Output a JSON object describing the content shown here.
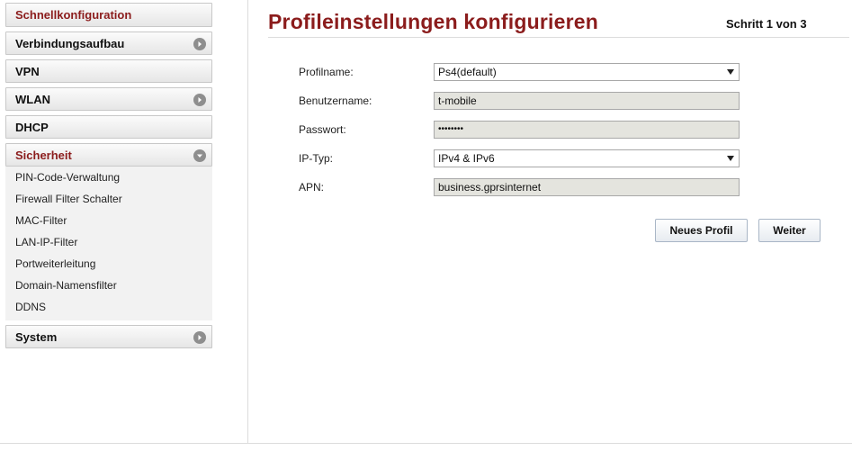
{
  "sidebar": {
    "items": [
      {
        "label": "Schnellkonfiguration"
      },
      {
        "label": "Verbindungsaufbau"
      },
      {
        "label": "VPN"
      },
      {
        "label": "WLAN"
      },
      {
        "label": "DHCP"
      },
      {
        "label": "Sicherheit"
      },
      {
        "label": "System"
      }
    ],
    "security_subitems": [
      {
        "label": "PIN-Code-Verwaltung"
      },
      {
        "label": "Firewall Filter Schalter"
      },
      {
        "label": "MAC-Filter"
      },
      {
        "label": "LAN-IP-Filter"
      },
      {
        "label": "Portweiterleitung"
      },
      {
        "label": "Domain-Namensfilter"
      },
      {
        "label": "DDNS"
      }
    ]
  },
  "main": {
    "title": "Profileinstellungen konfigurieren",
    "step": "Schritt 1 von 3",
    "form": {
      "profile_label": "Profilname:",
      "profile_value": "Ps4(default)",
      "username_label": "Benutzername:",
      "username_value": "t-mobile",
      "password_label": "Passwort:",
      "password_value": "••••••••",
      "iptype_label": "IP-Typ:",
      "iptype_value": "IPv4 & IPv6",
      "apn_label": "APN:",
      "apn_value": "business.gprsinternet"
    },
    "buttons": {
      "new_profile": "Neues Profil",
      "next": "Weiter"
    }
  },
  "colors": {
    "accent": "#8b1c1c",
    "field_bg": "#e4e4de"
  }
}
